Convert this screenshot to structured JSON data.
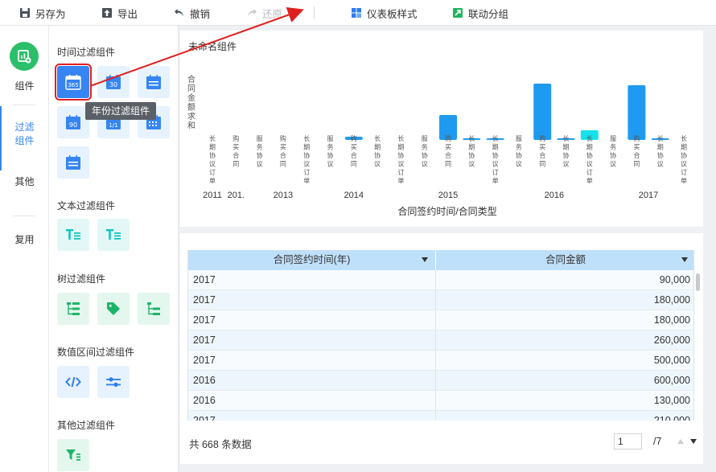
{
  "toolbar": {
    "save_as": "另存为",
    "export": "导出",
    "undo": "撤销",
    "redo": "还原",
    "dashboard_style": "仪表板样式",
    "linkage_group": "联动分组"
  },
  "leftnav": {
    "components": "组件",
    "filter": "过滤组件",
    "other": "其他",
    "reuse": "复用"
  },
  "panel": {
    "time_filter": "时间过滤组件",
    "text_filter": "文本过滤组件",
    "tree_filter": "树过滤组件",
    "range_filter": "数值区间过滤组件",
    "other_filter": "其他过滤组件",
    "tooltip": "年份过滤组件",
    "icon_365": "365",
    "icon_30": "30",
    "icon_90": "90",
    "icon_11": "1/1"
  },
  "chart_data": {
    "type": "bar",
    "title": "未命名组件",
    "ylabel": "合同金额求和",
    "xlabel": "合同签约时间/合同类型",
    "groups": [
      {
        "year": "2011",
        "categories": [
          "长期协议订单"
        ],
        "values": [
          0
        ]
      },
      {
        "year": "201.",
        "categories": [
          "购买合同"
        ],
        "values": [
          0
        ]
      },
      {
        "year": "2013",
        "categories": [
          "服务协议",
          "购买合同",
          "长期协议订单"
        ],
        "values": [
          0,
          0,
          0
        ]
      },
      {
        "year": "2014",
        "categories": [
          "服务协议",
          "购买合同",
          "长期协议"
        ],
        "values": [
          0,
          4,
          0
        ]
      },
      {
        "year": "2015",
        "categories": [
          "长期协议订单",
          "服务协议",
          "购买合同",
          "长期协议",
          "长期协议订单"
        ],
        "values": [
          0,
          0,
          31,
          0.5,
          0.5
        ]
      },
      {
        "year": "2016",
        "categories": [
          "服务协议",
          "购买合同",
          "长期协议",
          "长期协议订单"
        ],
        "values": [
          0,
          70,
          0.5,
          12
        ]
      },
      {
        "year": "2017",
        "categories": [
          "服务协议",
          "购买合同",
          "长期协议",
          "长期协议订单"
        ],
        "values": [
          0,
          68,
          0.5,
          0
        ]
      }
    ],
    "colors": {
      "blue": "#1e9bf0",
      "cyan": "#16e2ee"
    }
  },
  "table": {
    "col1": "合同签约时间(年)",
    "col2": "合同金额",
    "rows": [
      [
        "2017",
        "90,000"
      ],
      [
        "2017",
        "180,000"
      ],
      [
        "2017",
        "180,000"
      ],
      [
        "2017",
        "260,000"
      ],
      [
        "2017",
        "500,000"
      ],
      [
        "2016",
        "600,000"
      ],
      [
        "2016",
        "130,000"
      ],
      [
        "2017",
        "210,000"
      ]
    ],
    "total_text": "共  668  条数据",
    "page": "1",
    "page_total": "/7"
  }
}
